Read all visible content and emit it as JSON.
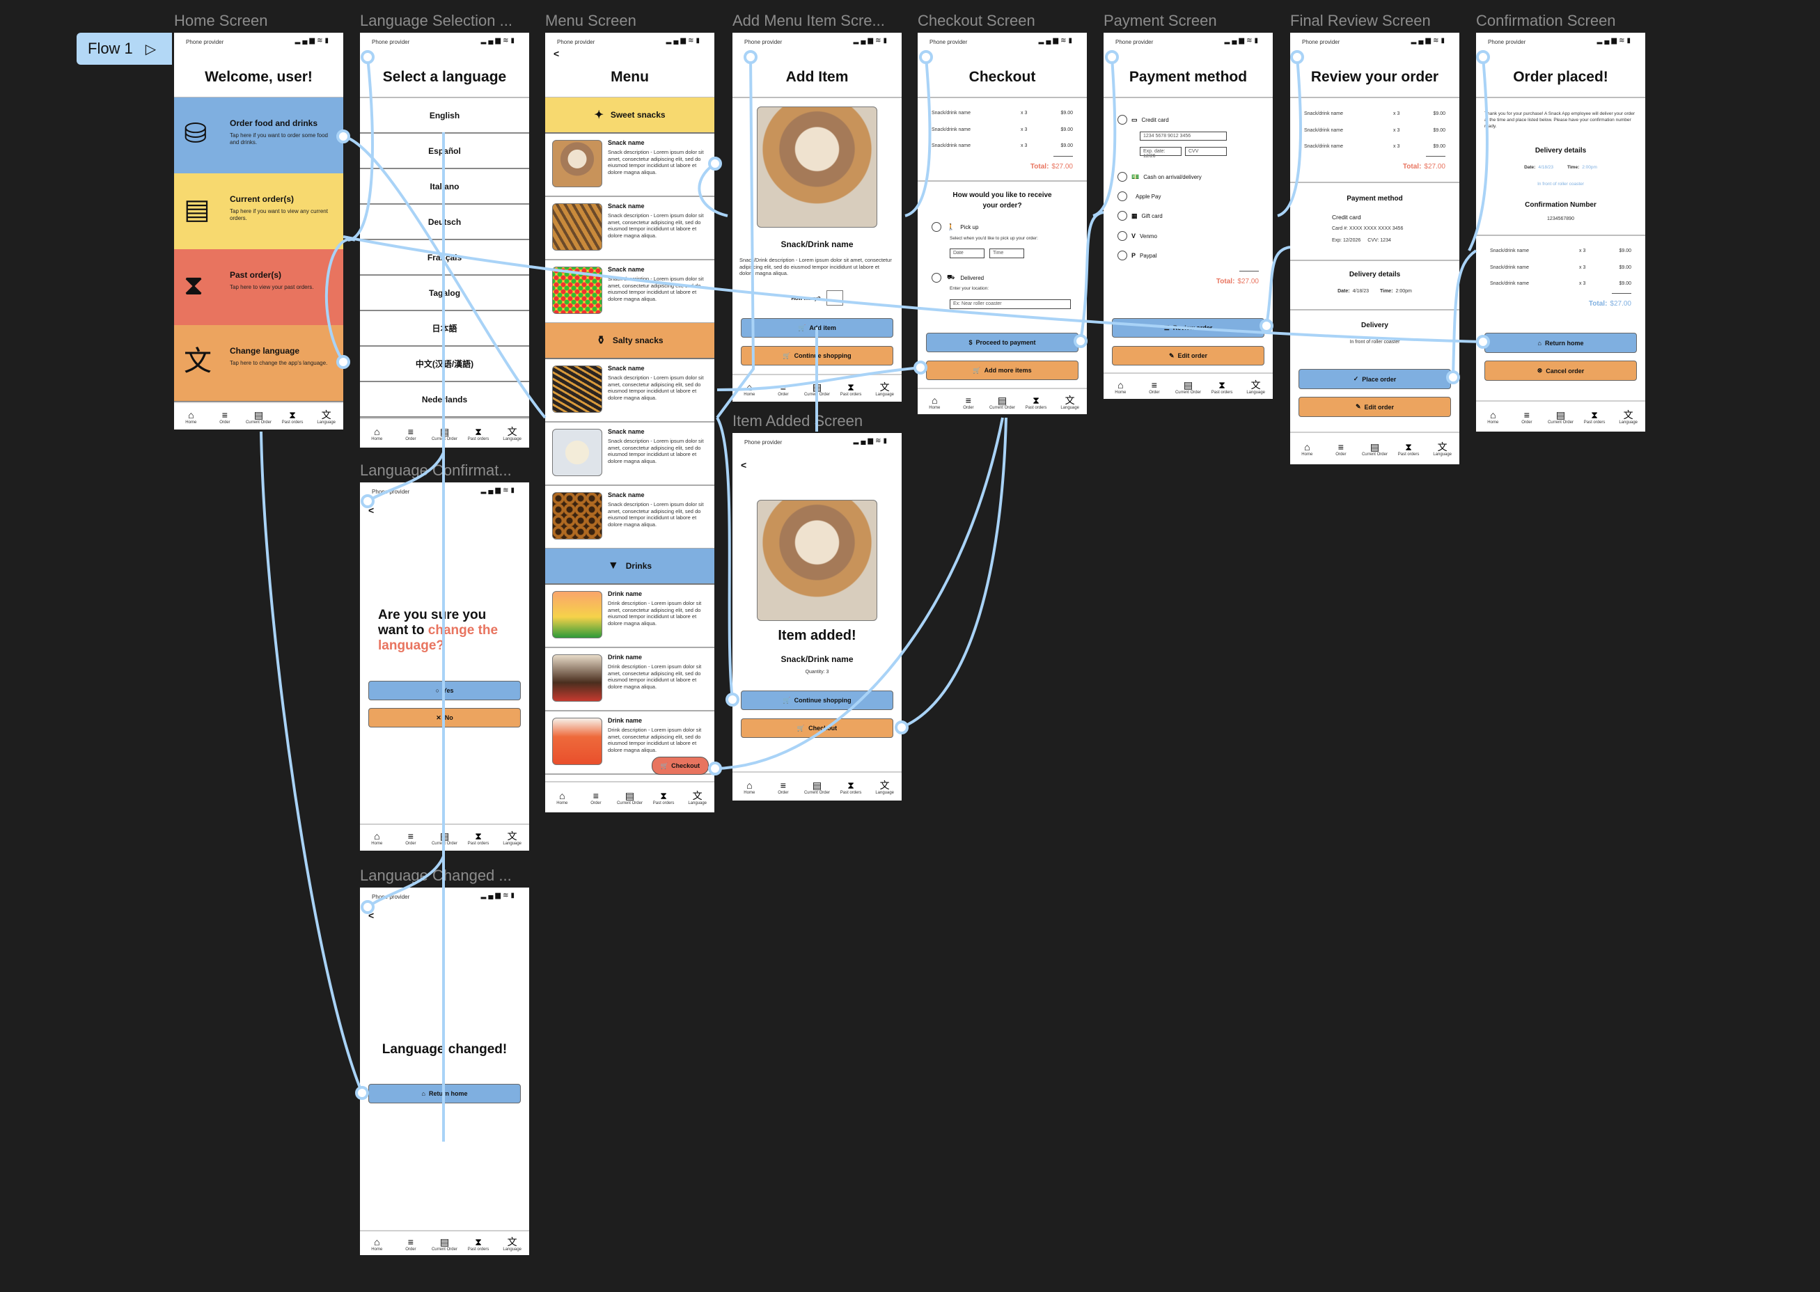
{
  "flow": {
    "label": "Flow 1"
  },
  "status": {
    "provider": "Phone provider"
  },
  "nav": [
    "Home",
    "Order",
    "Current Order",
    "Past orders",
    "Language"
  ],
  "colors": {
    "canvas": "#1e1e1e",
    "blue": "#7fafe0",
    "yellow": "#f7d96f",
    "red": "#e8745f",
    "orange": "#eca45f",
    "connector": "#a9d3f7",
    "total": "#e8745f",
    "info": "#7fafe0"
  },
  "home": {
    "label": "Home Screen",
    "title": "Welcome, user!",
    "tiles": [
      {
        "title": "Order food and drinks",
        "desc": "Tap here if you want to order some food and drinks.",
        "icon": "burger-drink-icon"
      },
      {
        "title": "Current order(s)",
        "desc": "Tap here if you want to view any current orders.",
        "icon": "receipt-icon"
      },
      {
        "title": "Past order(s)",
        "desc": "Tap here to view your past orders.",
        "icon": "receipt-hourglass-icon"
      },
      {
        "title": "Change language",
        "desc": "Tap here to change the app's language.",
        "icon": "translate-icon"
      }
    ]
  },
  "language": {
    "label": "Language Selection ...",
    "title": "Select a language",
    "options": [
      "English",
      "Español",
      "Italiano",
      "Deutsch",
      "Français",
      "Tagalog",
      "日本語",
      "中文(汉语/漢語)",
      "Nederlands"
    ]
  },
  "menu": {
    "label": "Menu Screen",
    "back": "<",
    "title": "Menu",
    "checkout": "Checkout",
    "sections": [
      {
        "name": "Sweet snacks",
        "icon": "candy-icon",
        "items": [
          {
            "name": "Snack name",
            "desc": "Snack description - Lorem ipsum dolor sit amet, consectetur adipiscing elit, sed do eiusmod tempor incididunt ut labore et dolore magna aliqua.",
            "image": "ice-cream-image"
          },
          {
            "name": "Snack name",
            "desc": "Snack description - Lorem ipsum dolor sit amet, consectetur adipiscing elit, sed do eiusmod tempor incididunt ut labore et dolore magna aliqua.",
            "image": "waffles-image"
          },
          {
            "name": "Snack name",
            "desc": "Snack description - Lorem ipsum dolor sit amet, consectetur adipiscing elit, sed do eiusmod tempor incididunt ut labore et dolore magna aliqua.",
            "image": "candy-image"
          }
        ]
      },
      {
        "name": "Salty snacks",
        "icon": "salt-shaker-icon",
        "items": [
          {
            "name": "Snack name",
            "desc": "Snack description - Lorem ipsum dolor sit amet, consectetur adipiscing elit, sed do eiusmod tempor incididunt ut labore et dolore magna aliqua.",
            "image": "fries-image"
          },
          {
            "name": "Snack name",
            "desc": "Snack description - Lorem ipsum dolor sit amet, consectetur adipiscing elit, sed do eiusmod tempor incididunt ut labore et dolore magna aliqua.",
            "image": "popcorn-image"
          },
          {
            "name": "Snack name",
            "desc": "Snack description - Lorem ipsum dolor sit amet, consectetur adipiscing elit, sed do eiusmod tempor incididunt ut labore et dolore magna aliqua.",
            "image": "pretzels-image"
          }
        ]
      },
      {
        "name": "Drinks",
        "icon": "cup-icon",
        "items": [
          {
            "name": "Drink name",
            "desc": "Drink description - Lorem ipsum dolor sit amet, consectetur adipiscing elit, sed do eiusmod tempor incididunt ut labore et dolore magna aliqua.",
            "image": "layered-drink-image"
          },
          {
            "name": "Drink name",
            "desc": "Drink description - Lorem ipsum dolor sit amet, consectetur adipiscing elit, sed do eiusmod tempor incididunt ut labore et dolore magna aliqua.",
            "image": "boba-tea-image"
          },
          {
            "name": "Drink name",
            "desc": "Drink description - Lorem ipsum dolor sit amet, consectetur adipiscing elit, sed do eiusmod tempor incididunt ut labore et dolore magna aliqua.",
            "image": "iced-drinks-image"
          }
        ]
      }
    ]
  },
  "add_item": {
    "label": "Add Menu Item Scre...",
    "title": "Add Item",
    "name": "Snack/Drink name",
    "desc": "Snack/Drink description - Lorem ipsum dolor sit amet, consectetur adipiscing elit, sed do eiusmod tempor incididunt ut labore et dolore magna aliqua.",
    "how_many": "How many?",
    "add": "Add item",
    "continue": "Continue shopping"
  },
  "item_added": {
    "label": "Item Added Screen",
    "back": "<",
    "title": "Item added!",
    "name": "Snack/Drink name",
    "quantity": "Quantity:  3",
    "continue": "Continue shopping",
    "checkout": "Checkout"
  },
  "order_items": [
    {
      "name": "Snack/drink name",
      "qty": "x 3",
      "price": "$9.00"
    },
    {
      "name": "Snack/drink name",
      "qty": "x 3",
      "price": "$9.00"
    },
    {
      "name": "Snack/drink name",
      "qty": "x 3",
      "price": "$9.00"
    }
  ],
  "checkout": {
    "label": "Checkout Screen",
    "title": "Checkout",
    "total_label": "Total:",
    "total": "$27.00",
    "question": "How would you like to receive your order?",
    "pickup": "Pick up",
    "pickup_hint": "Select when you'd like to pick up your order:",
    "date_ph": "Date",
    "time_ph": "Time",
    "delivered": "Delivered",
    "location_hint": "Enter your location:",
    "location_ph": "Ex: Near roller coaster",
    "proceed": "Proceed to payment",
    "add_more": "Add more items"
  },
  "payment": {
    "label": "Payment Screen",
    "title": "Payment method",
    "methods": [
      "Credit card",
      "Cash on arrival/delivery",
      "Apple Pay",
      "Gift card",
      "Venmo",
      "Paypal"
    ],
    "card_number": "1234 5678 9012 3456",
    "exp": "Exp. date:  12/26",
    "cvv": "CVV",
    "total_label": "Total:",
    "total": "$27.00",
    "review": "Review order",
    "edit": "Edit order"
  },
  "review": {
    "label": "Final Review Screen",
    "title": "Review your order",
    "total_label": "Total:",
    "total": "$27.00",
    "payment_heading": "Payment method",
    "payment_type": "Credit card",
    "card": "Card #:  XXXX XXXX XXXX 3456",
    "exp": "Exp:  12/2026",
    "cvv": "CVV:  1234",
    "delivery_details": "Delivery details",
    "date_label": "Date:",
    "date": "4/18/23",
    "time_label": "Time:",
    "time": "2:00pm",
    "delivery": "Delivery",
    "location": "In front of roller coaster",
    "place": "Place order",
    "edit": "Edit order"
  },
  "confirmation": {
    "label": "Confirmation Screen",
    "title": "Order placed!",
    "message": "Thank you for your purchase! A Snack App employee will deliver your order at the time and place listed below. Please have your confirmation number ready.",
    "delivery_details": "Delivery details",
    "date_label": "Date:",
    "date": "4/18/23",
    "time_label": "Time:",
    "time": "2:00pm",
    "location": "In front of roller coaster",
    "conf_heading": "Confirmation Number",
    "conf_number": "1234567890",
    "total_label": "Total:",
    "total": "$27.00",
    "return": "Return home",
    "cancel": "Cancel order"
  },
  "lang_confirm": {
    "label": "Language Confirmat...",
    "back": "<",
    "q1": "Are you sure you want to ",
    "q2": "change the language",
    "q3": "?",
    "yes": "Yes",
    "no": "No"
  },
  "lang_changed": {
    "label": "Language Changed ...",
    "back": "<",
    "title": "Language changed!",
    "return": "Return home"
  }
}
